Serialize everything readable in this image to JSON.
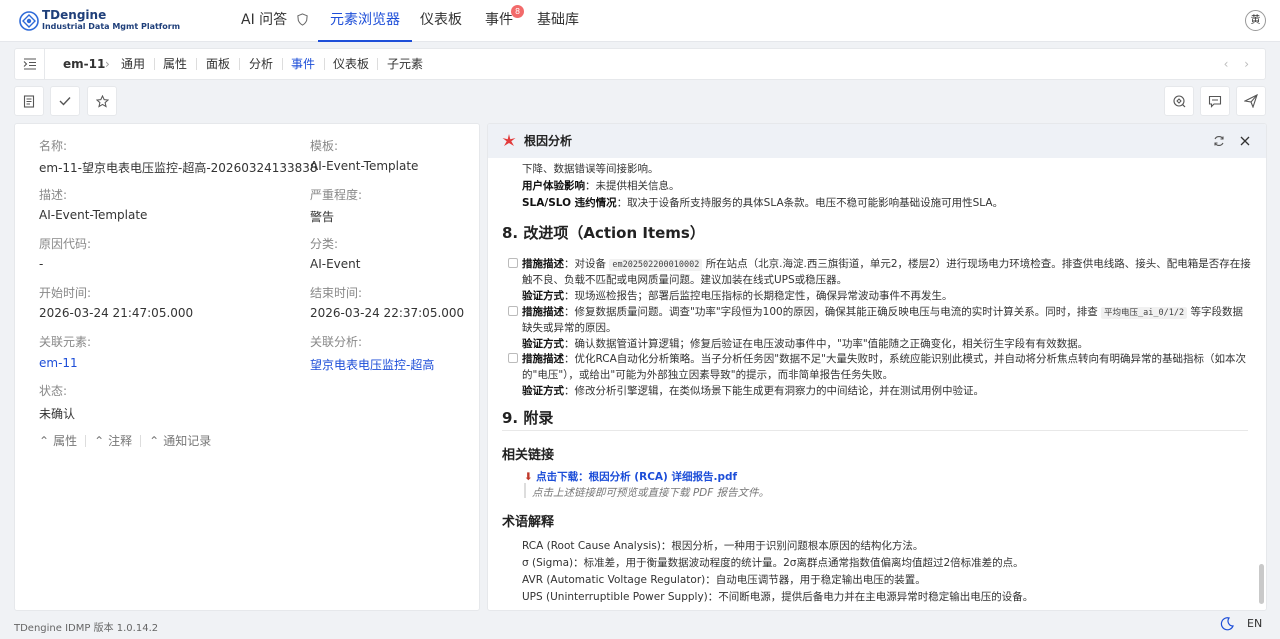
{
  "app": {
    "name": "TDengine",
    "subtitle": "Industrial Data Mgmt Platform",
    "user_avatar": "黄"
  },
  "nav": {
    "items": [
      "AI 问答",
      "元素浏览器",
      "仪表板",
      "事件",
      "基础库"
    ],
    "active": "元素浏览器",
    "event_badge": "8"
  },
  "breadcrumb": {
    "element": "em-11",
    "tabs": [
      "通用",
      "属性",
      "面板",
      "分析",
      "事件",
      "仪表板",
      "子元素"
    ],
    "active_tab": "事件"
  },
  "event_detail": {
    "name_label": "名称:",
    "name_value": "em-11-望京电表电压监控-超高-20260324133838",
    "template_label": "模板:",
    "template_value": "AI-Event-Template",
    "desc_label": "描述:",
    "desc_value": "AI-Event-Template",
    "severity_label": "严重程度:",
    "severity_value": "警告",
    "reason_label": "原因代码:",
    "reason_value": "-",
    "category_label": "分类:",
    "category_value": "AI-Event",
    "start_label": "开始时间:",
    "start_value": "2026-03-24 21:47:05.000",
    "end_label": "结束时间:",
    "end_value": "2026-03-24 22:37:05.000",
    "elem_label": "关联元素:",
    "elem_value": "em-11",
    "analysis_label": "关联分析:",
    "analysis_value": "望京电表电压监控-超高",
    "status_label": "状态:",
    "status_value": "未确认",
    "bottom_tabs": [
      "属性",
      "注释",
      "通知记录"
    ]
  },
  "rca": {
    "title": "根因分析",
    "line_top": "下降、数据错误等间接影响。",
    "ux_label": "用户体验影响",
    "ux_text": "：未提供相关信息。",
    "sla_label": "SLA/SLO 违约情况",
    "sla_text": "：取决于设备所支持服务的具体SLA条款。电压不稳可能影响基础设施可用性SLA。",
    "section8": "8. 改进项（Action Items）",
    "actions": [
      {
        "desc_label": "措施描述",
        "desc_pre": "：对设备",
        "code": "em202502200010002",
        "desc_post": "所在站点（北京.海淀.西三旗街道，单元2，楼层2）进行现场电力环境检查。排查供电线路、接头、配电箱是否存在接",
        "desc_line2": "触不良、负载不匹配或电网质量问题。建议加装在线式UPS或稳压器。",
        "verify_label": "验证方式",
        "verify_text": "：现场巡检报告；部署后监控电压指标的长期稳定性，确保异常波动事件不再发生。"
      },
      {
        "desc_label": "措施描述",
        "desc_pre": "：修复数据质量问题。调查\"功率\"字段恒为100的原因，确保其能正确反映电压与电流的实时计算关系。同时，排查",
        "code": "平均电压_ai_0/1/2",
        "desc_post": "等字段数据",
        "desc_line2": "缺失或异常的原因。",
        "verify_label": "验证方式",
        "verify_text": "：确认数据管道计算逻辑；修复后验证在电压波动事件中，\"功率\"值能随之正确变化，相关衍生字段有有效数据。"
      },
      {
        "desc_label": "措施描述",
        "desc_pre": "：优化RCA自动化分析策略。当子分析任务因\"数据不足\"大量失败时，系统应能识别此模式，并自动将分析焦点转向有明确异常的基础指标（如本次",
        "code": "",
        "desc_post": "",
        "desc_line2": "的\"电压\"），或给出\"可能为外部独立因素导致\"的提示，而非简单报告任务失败。",
        "verify_label": "验证方式",
        "verify_text": "：修改分析引擎逻辑，在类似场景下能生成更有洞察力的中间结论，并在测试用例中验证。"
      }
    ],
    "section9": "9. 附录",
    "links_heading": "相关链接",
    "download_label": "点击下载：",
    "download_link": "根因分析 (RCA) 详细报告.pdf",
    "download_hint": "点击上述链接即可预览或直接下载 PDF 报告文件。",
    "glossary_heading": "术语解释",
    "glossary": [
      {
        "term": "RCA (Root Cause Analysis)",
        "def": "：根因分析，一种用于识别问题根本原因的结构化方法。"
      },
      {
        "term": "σ (Sigma)",
        "def": "：标准差，用于衡量数据波动程度的统计量。2σ离群点通常指数值偏离均值超过2倍标准差的点。"
      },
      {
        "term": "AVR (Automatic Voltage Regulator)",
        "def": "：自动电压调节器，用于稳定输出电压的装置。"
      },
      {
        "term": "UPS (Uninterruptible Power Supply)",
        "def": "：不间断电源，提供后备电力并在主电源异常时稳定输出电压的设备。"
      }
    ]
  },
  "footer": {
    "version": "TDengine IDMP 版本 1.0.14.2",
    "lang": "EN"
  },
  "colors": {
    "accent": "#1d4ed8",
    "badge": "#f26a6a",
    "panel_header": "#eef1f6"
  }
}
